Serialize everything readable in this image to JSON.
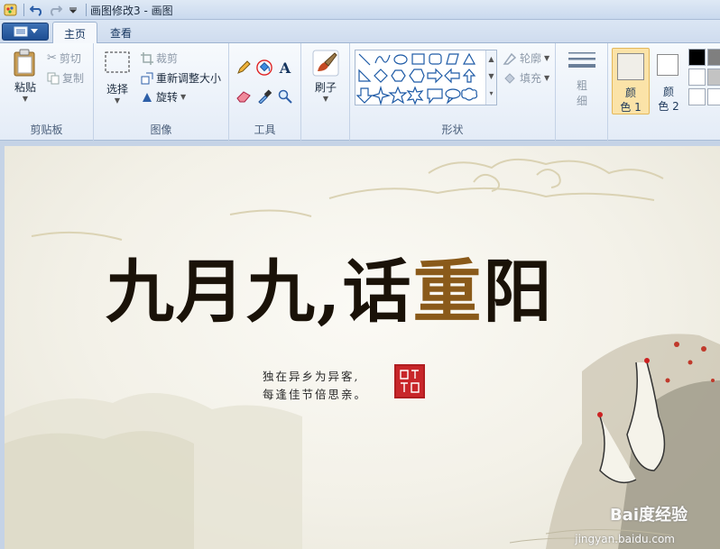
{
  "window": {
    "title": "画图修改3 - 画图"
  },
  "tabs": [
    {
      "label": "主页"
    },
    {
      "label": "查看"
    }
  ],
  "ribbon": {
    "clipboard": {
      "paste_label": "粘贴",
      "cut_label": "剪切",
      "copy_label": "复制",
      "group_label": "剪贴板"
    },
    "image": {
      "select_label": "选择",
      "crop_label": "裁剪",
      "resize_label": "重新调整大小",
      "rotate_label": "旋转",
      "group_label": "图像"
    },
    "tools": {
      "group_label": "工具",
      "text_glyph": "A"
    },
    "brushes": {
      "label": "刷子"
    },
    "shapes": {
      "outline_label": "轮廓",
      "fill_label": "填充",
      "group_label": "形状"
    },
    "size": {
      "label_line1": "粗",
      "label_line2": "细"
    },
    "colors": {
      "color1_line1": "颜",
      "color1_line2": "色 1",
      "color2_line1": "颜",
      "color2_line2": "色 2",
      "color1_value": "#f0eee8",
      "color2_value": "#ffffff",
      "palette": [
        "#000000",
        "#7f7f7f",
        "#ffffff",
        "#c3c3c3",
        "#ffffff",
        "#ffffff"
      ]
    }
  },
  "canvas": {
    "headline_black": "九月九,话",
    "headline_gold": "重",
    "headline_last": "阳",
    "poem_line1": "独在异乡为异客,",
    "poem_line2": "每逢佳节倍思亲。",
    "watermark": "Bai度经验",
    "watermark_url": "jingyan.baidu.com"
  },
  "colors": {
    "accent": "#1d4e93",
    "highlight_circle": "#e02020",
    "ribbon_bg": "#e4ecf7",
    "canvas_frame": "#c5d3e6",
    "selected_color_box": "#fbe3a8"
  }
}
